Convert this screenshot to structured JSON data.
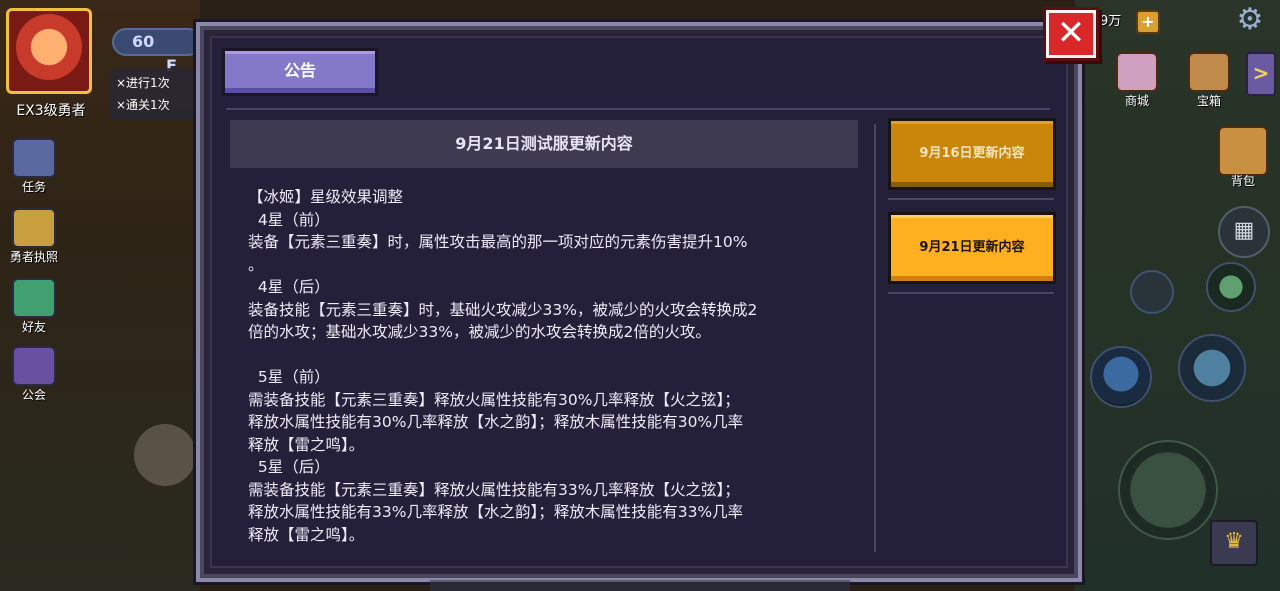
{
  "hud": {
    "rank_label": "EX3级勇者",
    "energy": "60",
    "energy_suffix": "F",
    "task_tips": [
      "×进行1次",
      "×通关1次"
    ],
    "side_buttons": [
      "任务",
      "勇者执照",
      "好友",
      "公会"
    ],
    "money": "9万",
    "plus": "+",
    "right_buttons": [
      "商城",
      "宝箱"
    ],
    "bag_label": "背包",
    "arrow": ">",
    "grid_icon": "▦",
    "crown_icon": "♛"
  },
  "dialog": {
    "close_label": "✕",
    "tab_label": "公告",
    "content_title": "9月21日测试服更新内容",
    "content_text": "【冰姬】星级效果调整\n  4星（前）\n装备【元素三重奏】时，属性攻击最高的那一项对应的元素伤害提升10%\n。\n  4星（后）\n装备技能【元素三重奏】时，基础火攻减少33%，被减少的火攻会转换成2\n倍的水攻；基础水攻减少33%，被减少的水攻会转换成2倍的火攻。\n\n  5星（前）\n需装备技能【元素三重奏】释放火属性技能有30%几率释放【火之弦】；\n释放水属性技能有30%几率释放【水之韵】；释放木属性技能有30%几率\n释放【雷之鸣】。\n  5星（后）\n需装备技能【元素三重奏】释放火属性技能有33%几率释放【火之弦】；\n释放水属性技能有33%几率释放【水之韵】；释放木属性技能有33%几率\n释放【雷之鸣】。",
    "side_tabs": [
      {
        "label": "9月16日更新内容",
        "active": false
      },
      {
        "label": "9月21日更新内容",
        "active": true
      }
    ]
  },
  "colors": {
    "dialog_bg": "#24203a",
    "tab_purple": "#8478c8",
    "tab_orange_active": "#ffb020",
    "tab_orange_inactive": "#c8860a",
    "close_red": "#d8282a"
  }
}
